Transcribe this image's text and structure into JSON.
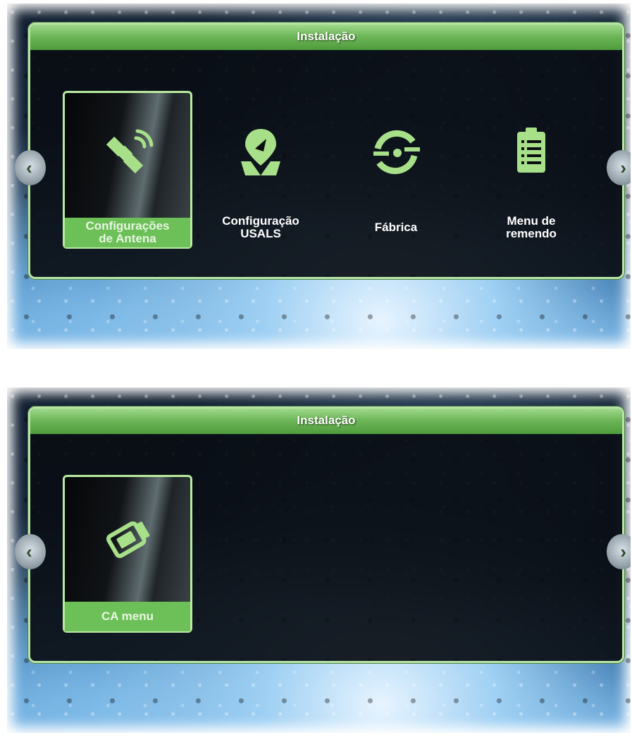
{
  "screens": [
    {
      "title": "Instalação",
      "items": [
        {
          "label": "Configurações\nde Antena",
          "icon": "satellite-icon",
          "selected": true
        },
        {
          "label": "Configuração\nUSALS",
          "icon": "map-pin-icon",
          "selected": false
        },
        {
          "label": "Fábrica",
          "icon": "factory-reset-icon",
          "selected": false
        },
        {
          "label": "Menu de\nremendo",
          "icon": "clipboard-icon",
          "selected": false
        }
      ]
    },
    {
      "title": "Instalação",
      "items": [
        {
          "label": "CA menu",
          "icon": "ca-card-icon",
          "selected": true
        }
      ]
    }
  ],
  "colors": {
    "accent": "#6cc057",
    "title_bar": "#6db659",
    "panel_border": "#b7e4a6",
    "icon": "#a8e089"
  },
  "nav": {
    "left_icon": "chevron-left-icon",
    "right_icon": "chevron-right-icon"
  }
}
